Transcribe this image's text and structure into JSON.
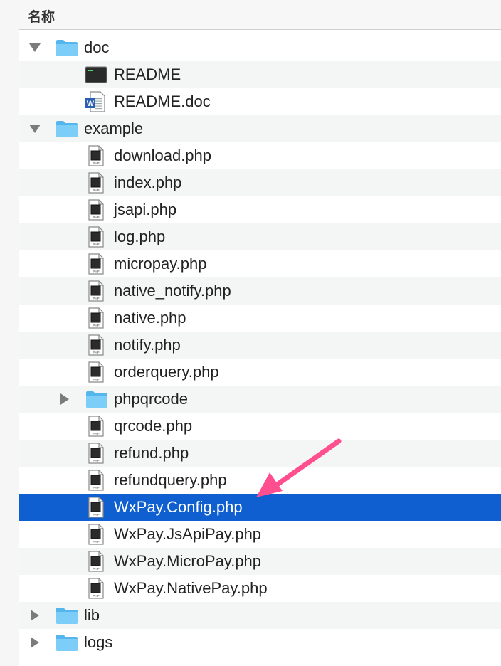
{
  "header": {
    "name_column": "名称"
  },
  "rows": [
    {
      "label": "doc",
      "level": 0,
      "type": "folder",
      "disclosure": "expanded"
    },
    {
      "label": "README",
      "level": 1,
      "type": "terminal"
    },
    {
      "label": "README.doc",
      "level": 1,
      "type": "word"
    },
    {
      "label": "example",
      "level": 0,
      "type": "folder",
      "disclosure": "expanded"
    },
    {
      "label": "download.php",
      "level": 1,
      "type": "php"
    },
    {
      "label": "index.php",
      "level": 1,
      "type": "php"
    },
    {
      "label": "jsapi.php",
      "level": 1,
      "type": "php"
    },
    {
      "label": "log.php",
      "level": 1,
      "type": "php"
    },
    {
      "label": "micropay.php",
      "level": 1,
      "type": "php"
    },
    {
      "label": "native_notify.php",
      "level": 1,
      "type": "php"
    },
    {
      "label": "native.php",
      "level": 1,
      "type": "php"
    },
    {
      "label": "notify.php",
      "level": 1,
      "type": "php"
    },
    {
      "label": "orderquery.php",
      "level": 1,
      "type": "php"
    },
    {
      "label": "phpqrcode",
      "level": 1,
      "type": "folder",
      "disclosure": "collapsed"
    },
    {
      "label": "qrcode.php",
      "level": 1,
      "type": "php"
    },
    {
      "label": "refund.php",
      "level": 1,
      "type": "php"
    },
    {
      "label": "refundquery.php",
      "level": 1,
      "type": "php"
    },
    {
      "label": "WxPay.Config.php",
      "level": 1,
      "type": "php",
      "selected": true
    },
    {
      "label": "WxPay.JsApiPay.php",
      "level": 1,
      "type": "php"
    },
    {
      "label": "WxPay.MicroPay.php",
      "level": 1,
      "type": "php"
    },
    {
      "label": "WxPay.NativePay.php",
      "level": 1,
      "type": "php"
    },
    {
      "label": "lib",
      "level": 0,
      "type": "folder",
      "disclosure": "collapsed"
    },
    {
      "label": "logs",
      "level": 0,
      "type": "folder",
      "disclosure": "collapsed"
    }
  ],
  "file_icon_caption": "PHP",
  "colors": {
    "selection": "#0f5fd0",
    "folder": "#6ec5f5",
    "arrow": "#ff4f8f"
  }
}
